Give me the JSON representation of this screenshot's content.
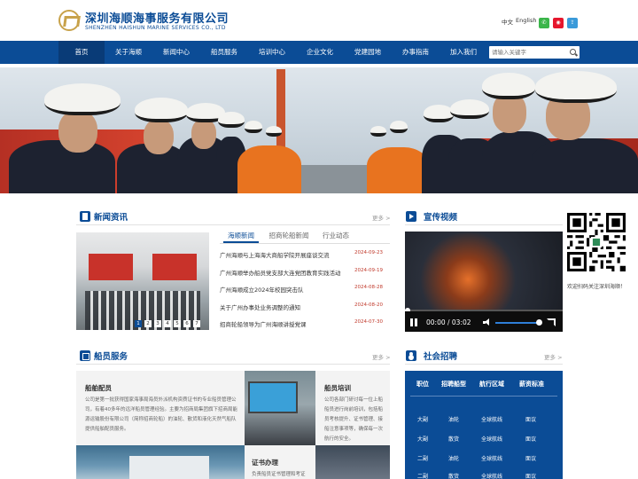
{
  "header": {
    "logo_cn": "深圳海顺海事服务有限公司",
    "logo_en": "SHENZHEN HAISHUN MARINE SERVICES CO., LTD",
    "lang_zh": "中文",
    "lang_en": "English",
    "social": [
      "wechat-icon",
      "weibo-icon",
      "share-icon"
    ]
  },
  "nav": {
    "items": [
      "首页",
      "关于海顺",
      "新闻中心",
      "船员服务",
      "培训中心",
      "企业文化",
      "党建园地",
      "办事指南",
      "加入我们"
    ],
    "active_index": 0,
    "search_placeholder": "请输入关键字"
  },
  "news": {
    "title": "新闻资讯",
    "more": "更多 >",
    "tabs": [
      "海顺新闻",
      "招商轮船新闻",
      "行业动态"
    ],
    "active_tab": 0,
    "slide_dots": [
      "1",
      "2",
      "3",
      "4",
      "5",
      "6",
      "7"
    ],
    "active_dot": 0,
    "items": [
      {
        "title": "广州海顺与上海海大商船学院开展座谈交流",
        "date": "2024-09-23"
      },
      {
        "title": "广州海顺举办船员党支部大连党团教育实践活动",
        "date": "2024-09-19"
      },
      {
        "title": "广州海顺成立2024年校园突击队",
        "date": "2024-08-28"
      },
      {
        "title": "关于广州办事处业务调整的通知",
        "date": "2024-08-20"
      },
      {
        "title": "招商轮船领导为广州海顺讲授党课",
        "date": "2024-07-30"
      }
    ]
  },
  "video": {
    "title": "宣传视频",
    "time": "00:00 / 03:02",
    "progress": 0.0,
    "volume": 0.85
  },
  "qr": {
    "caption": "欢迎扫码关注深圳海顺！"
  },
  "services": {
    "title": "船员服务",
    "more": "更多 >",
    "panels": [
      {
        "title": "船舶配员",
        "desc": "公司是第一批获得国家海事局海员外派机构资质证书的专业船员管理公司，有着40多年的远洋船员管理经验。主要为招商局集团旗下招商局能源运输股份有限公司（简称招商轮船）的油轮、散货和液化天然气船队提供船舶配员服务。"
      },
      {
        "title": "船员培训",
        "desc": "公司各部门研讨每一位上船船员进行岗前培训，包括船员考核提升、证书管理、接船注意事项等，确保每一次航行的安全。"
      },
      {
        "title": "证书办理",
        "desc": "负责船员证书管理和考证"
      }
    ]
  },
  "recruit": {
    "title": "社会招聘",
    "more": "更多 >",
    "headers": [
      "职位",
      "招聘船型",
      "航行区域",
      "薪资标准"
    ],
    "rows": [
      [
        "大副",
        "油轮",
        "全球航线",
        "面议"
      ],
      [
        "大副",
        "散货",
        "全球航线",
        "面议"
      ],
      [
        "二副",
        "油轮",
        "全球航线",
        "面议"
      ],
      [
        "二副",
        "散货",
        "全球航线",
        "面议"
      ]
    ]
  },
  "colors": {
    "brand_blue": "#0b4c96",
    "nav_active": "#093b77",
    "date_red": "#c0392b",
    "logo_gold": "#c8a24a"
  }
}
